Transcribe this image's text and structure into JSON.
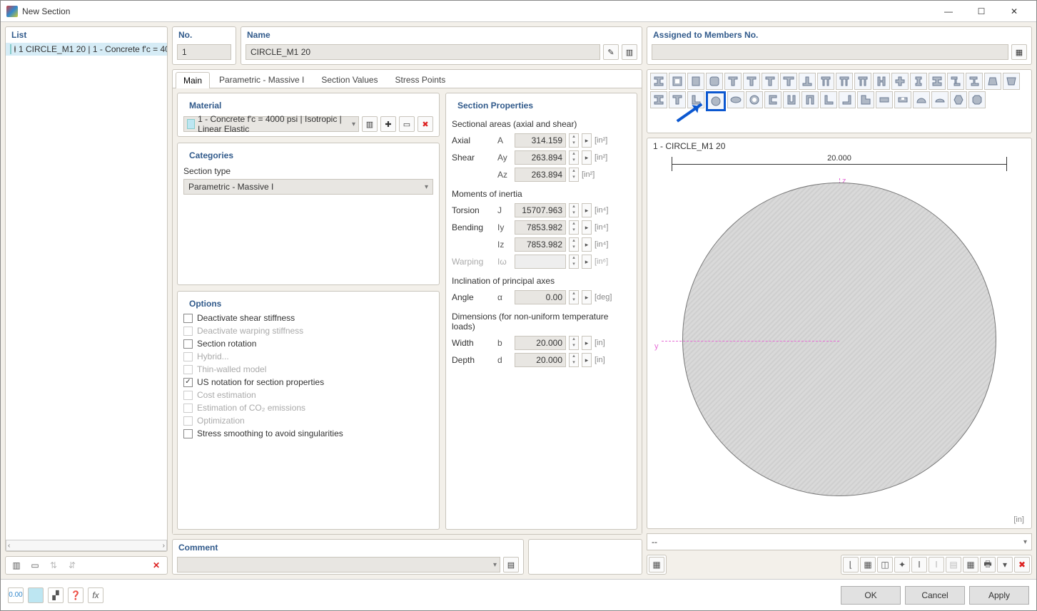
{
  "window": {
    "title": "New Section"
  },
  "left": {
    "header": "List",
    "items": [
      {
        "text": "1 CIRCLE_M1 20 | 1 - Concrete f'c = 40"
      }
    ]
  },
  "no": {
    "header": "No.",
    "value": "1"
  },
  "name": {
    "header": "Name",
    "value": "CIRCLE_M1 20"
  },
  "assigned": {
    "header": "Assigned to Members No."
  },
  "tabs": {
    "main": "Main",
    "param": "Parametric - Massive I",
    "secval": "Section Values",
    "stress": "Stress Points"
  },
  "material": {
    "header": "Material",
    "value": "1 - Concrete f'c = 4000 psi | Isotropic | Linear Elastic"
  },
  "categories": {
    "header": "Categories",
    "section_type_label": "Section type",
    "section_type_value": "Parametric - Massive I"
  },
  "options": {
    "header": "Options",
    "deact_shear": "Deactivate shear stiffness",
    "deact_warp": "Deactivate warping stiffness",
    "sec_rot": "Section rotation",
    "hybrid": "Hybrid...",
    "thin": "Thin-walled model",
    "usnot": "US notation for section properties",
    "cost": "Cost estimation",
    "co2": "Estimation of CO₂ emissions",
    "opt": "Optimization",
    "smooth": "Stress smoothing to avoid singularities"
  },
  "props": {
    "header": "Section Properties",
    "areas_hdr": "Sectional areas (axial and shear)",
    "axial": {
      "label": "Axial",
      "sym": "A",
      "val": "314.159",
      "unit": "[in²]"
    },
    "shear_y": {
      "label": "Shear",
      "sym": "Ay",
      "val": "263.894",
      "unit": "[in²]"
    },
    "shear_z": {
      "label": "",
      "sym": "Az",
      "val": "263.894",
      "unit": "[in²]"
    },
    "mom_hdr": "Moments of inertia",
    "torsion": {
      "label": "Torsion",
      "sym": "J",
      "val": "15707.963",
      "unit": "[in⁴]"
    },
    "bend_y": {
      "label": "Bending",
      "sym": "Iy",
      "val": "7853.982",
      "unit": "[in⁴]"
    },
    "bend_z": {
      "label": "",
      "sym": "Iz",
      "val": "7853.982",
      "unit": "[in⁴]"
    },
    "warp": {
      "label": "Warping",
      "sym": "Iω",
      "val": "",
      "unit": "[in⁶]"
    },
    "incl_hdr": "Inclination of principal axes",
    "angle": {
      "label": "Angle",
      "sym": "α",
      "val": "0.00",
      "unit": "[deg]"
    },
    "dim_hdr": "Dimensions (for non-uniform temperature loads)",
    "width": {
      "label": "Width",
      "sym": "b",
      "val": "20.000",
      "unit": "[in]"
    },
    "depth": {
      "label": "Depth",
      "sym": "d",
      "val": "20.000",
      "unit": "[in]"
    }
  },
  "comment": {
    "header": "Comment"
  },
  "preview": {
    "title": "1 - CIRCLE_M1 20",
    "dim": "20.000",
    "unit": "[in]",
    "z": "z",
    "y": "y",
    "dd": "--"
  },
  "buttons": {
    "ok": "OK",
    "cancel": "Cancel",
    "apply": "Apply"
  }
}
